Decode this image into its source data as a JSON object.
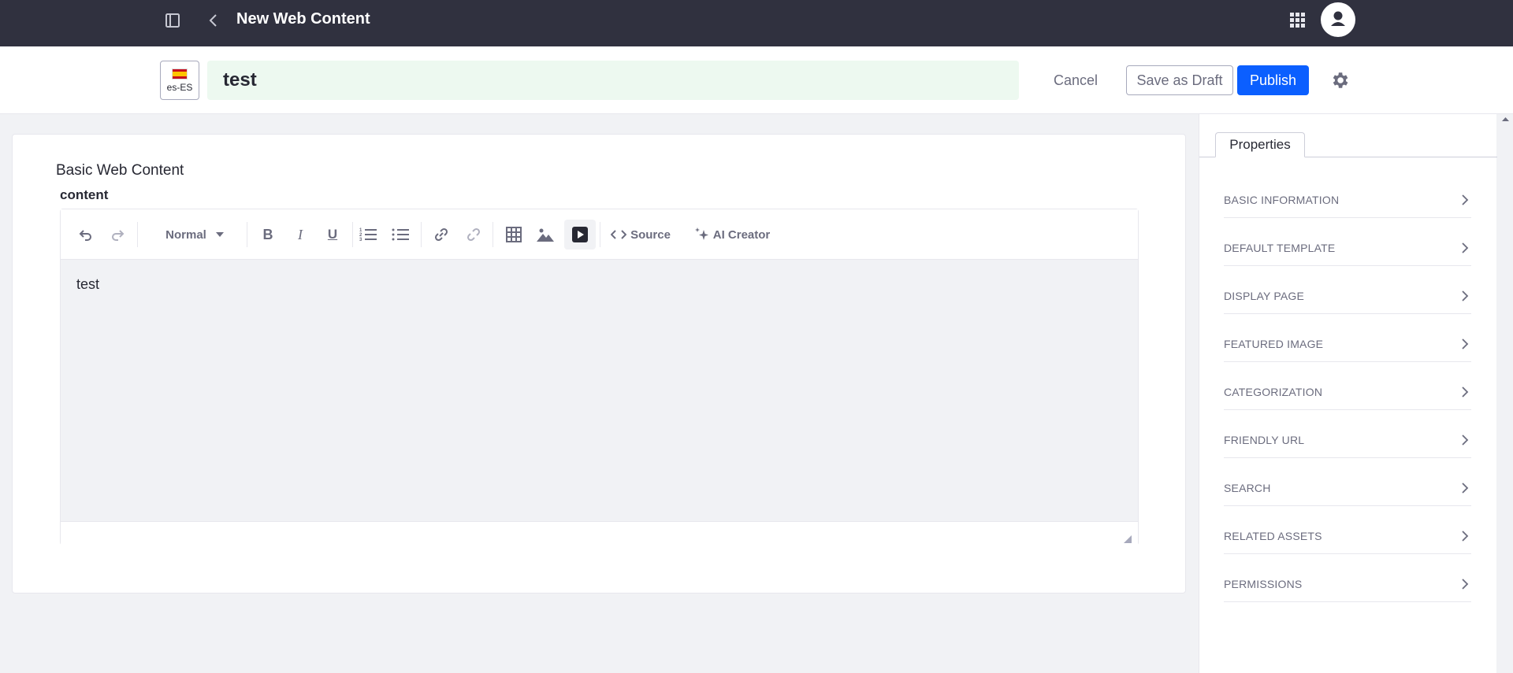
{
  "topbar": {
    "title": "New Web Content"
  },
  "header": {
    "locale_code": "es-ES",
    "title_value": "test",
    "cancel_label": "Cancel",
    "save_draft_label": "Save as Draft",
    "publish_label": "Publish"
  },
  "content": {
    "structure_title": "Basic Web Content",
    "field_label": "content",
    "toolbar": {
      "paragraph_format": "Normal",
      "source_label": "Source",
      "ai_creator_label": "AI Creator"
    },
    "body_text": "test"
  },
  "sidebar": {
    "tab_label": "Properties",
    "items": [
      {
        "label": "BASIC INFORMATION"
      },
      {
        "label": "DEFAULT TEMPLATE"
      },
      {
        "label": "DISPLAY PAGE"
      },
      {
        "label": "FEATURED IMAGE"
      },
      {
        "label": "CATEGORIZATION"
      },
      {
        "label": "FRIENDLY URL"
      },
      {
        "label": "SEARCH"
      },
      {
        "label": "RELATED ASSETS"
      },
      {
        "label": "PERMISSIONS"
      }
    ]
  },
  "colors": {
    "topbar_bg": "#30313f",
    "publish_blue": "#0b5fff",
    "title_input_bg": "#edf9f0",
    "page_bg": "#f1f2f5"
  },
  "icons": [
    "sidebar-toggle-icon",
    "back-arrow-icon",
    "apps-grid-icon",
    "user-avatar-icon",
    "flag-es-icon",
    "gear-icon",
    "undo-icon",
    "redo-icon",
    "bold-icon",
    "italic-icon",
    "underline-icon",
    "numbered-list-icon",
    "bulleted-list-icon",
    "link-icon",
    "unlink-icon",
    "table-icon",
    "image-icon",
    "video-icon",
    "code-icon",
    "sparkles-icon",
    "chevron-right-icon"
  ]
}
